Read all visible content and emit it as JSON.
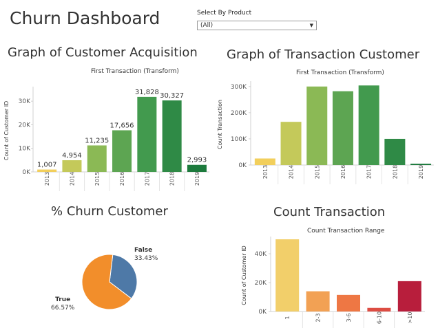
{
  "header": {
    "title": "Churn Dashboard"
  },
  "filter": {
    "label": "Select By Product",
    "value": "(All)"
  },
  "charts": [
    {
      "section_title": "Graph of Customer Acquisition",
      "chart_data": {
        "type": "bar",
        "title": "First Transaction (Transform)",
        "xlabel": "",
        "ylabel": "Count of Customer ID",
        "categories": [
          "2013",
          "2014",
          "2015",
          "2016",
          "2017",
          "2018",
          "2019"
        ],
        "values": [
          1007,
          4954,
          11235,
          17656,
          31828,
          30327,
          2993
        ],
        "data_labels": [
          "1,007",
          "4,954",
          "11,235",
          "17,656",
          "31,828",
          "30,327",
          "2,993"
        ],
        "colors": [
          "#f2cf5c",
          "#c4c95a",
          "#8bb955",
          "#5da552",
          "#429a4e",
          "#2f8a46",
          "#1c7a3c"
        ],
        "yticks": [
          0,
          10000,
          20000,
          30000
        ],
        "ytick_labels": [
          "0K",
          "10K",
          "20K",
          "30K"
        ],
        "ylim": [
          0,
          35000
        ],
        "grid": false
      }
    },
    {
      "section_title": "Graph of Transaction Customer",
      "chart_data": {
        "type": "bar",
        "title": "First Transaction (Transform)",
        "xlabel": "",
        "ylabel": "Count Transaction",
        "categories": [
          "2013",
          "2014",
          "2015",
          "2016",
          "2017",
          "2018",
          "2019"
        ],
        "values": [
          25000,
          165000,
          300000,
          282000,
          304000,
          100000,
          5000
        ],
        "colors": [
          "#f2cf5c",
          "#c4c95a",
          "#8bb955",
          "#5da552",
          "#429a4e",
          "#2f8a46",
          "#1c7a3c"
        ],
        "yticks": [
          0,
          100000,
          200000,
          300000
        ],
        "ytick_labels": [
          "0K",
          "100K",
          "200K",
          "300K"
        ],
        "ylim": [
          0,
          310000
        ],
        "grid": false
      }
    },
    {
      "section_title": "% Churn Customer",
      "chart_data": {
        "type": "pie",
        "slices": [
          {
            "label": "False",
            "pct_label": "33.43%",
            "value": 33.43,
            "color": "#4e79a7"
          },
          {
            "label": "True",
            "pct_label": "66.57%",
            "value": 66.57,
            "color": "#f28e2b"
          }
        ],
        "legend": "none"
      }
    },
    {
      "section_title": "Count Transaction",
      "chart_data": {
        "type": "bar",
        "title": "Count Transaction Range",
        "xlabel": "",
        "ylabel": "Count of Customer ID",
        "categories": [
          "1",
          "2-3",
          "3-6",
          "6-10",
          ">10"
        ],
        "values": [
          50000,
          14000,
          11500,
          2500,
          21000
        ],
        "colors": [
          "#f2cf6a",
          "#f2a154",
          "#ee7744",
          "#dd4d43",
          "#b81e3c"
        ],
        "yticks": [
          0,
          20000,
          40000
        ],
        "ytick_labels": [
          "0K",
          "20K",
          "40K"
        ],
        "ylim": [
          0,
          50000
        ],
        "grid": false
      }
    }
  ]
}
